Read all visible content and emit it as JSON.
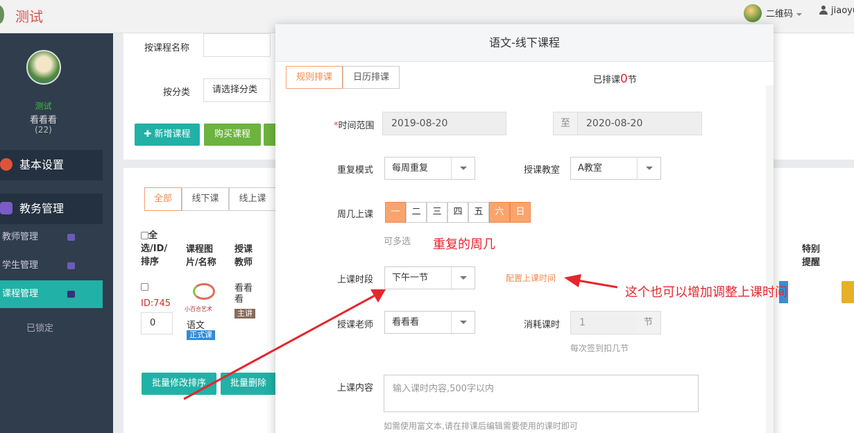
{
  "app": {
    "title": "测试"
  },
  "topbar": {
    "qr_label": "二维码",
    "user_label": "jiaoyu"
  },
  "sidebar": {
    "name_line1": "测试",
    "name_line2": "看看看",
    "count": "(22)",
    "section_basic": "基本设置",
    "section_edu": "教务管理",
    "items": [
      "教师管理",
      "学生管理",
      "课程管理"
    ],
    "locked": "已锁定"
  },
  "filters": {
    "by_name_label": "按课程名称",
    "by_category_label": "按分类",
    "category_select": "请选择分类"
  },
  "actions": {
    "new_course": "新增课程",
    "buy_course": "购买课程"
  },
  "list_tabs": [
    "全部",
    "线下课",
    "线上课"
  ],
  "table": {
    "headers": [
      "全选/ID/排序",
      "课程图片/名称",
      "授课教师",
      "特别提醒"
    ],
    "row": {
      "id": "ID:745",
      "sort": "0",
      "logo_text": "小百合艺术",
      "course_name": "语文",
      "course_tag": "正式课",
      "teacher": "看看看",
      "teacher_tag": "主讲"
    }
  },
  "bulk": {
    "edit_sort": "批量修改排序",
    "delete": "批量删除"
  },
  "modal": {
    "title": "语文-线下课程",
    "tab_rule": "规则排课",
    "tab_calendar": "日历排课",
    "scheduled_prefix": "已排课",
    "scheduled_count": "0",
    "scheduled_suffix": "节",
    "time_range_label": "时间范围",
    "date_from": "2019-08-20",
    "to_label": "至",
    "date_to": "2020-08-20",
    "repeat_label": "重复模式",
    "repeat_value": "每周重复",
    "classroom_label": "授课教室",
    "classroom_value": "A教室",
    "weekday_label": "周几上课",
    "weekdays": [
      "一",
      "二",
      "三",
      "四",
      "五",
      "六",
      "日"
    ],
    "weekday_selected": [
      true,
      false,
      false,
      false,
      false,
      true,
      true
    ],
    "multi_hint": "可多选",
    "period_label": "上课时段",
    "period_value": "下午一节",
    "config_link": "配置上课时间",
    "teacher_label": "授课老师",
    "teacher_value": "看看看",
    "consume_label": "消耗课时",
    "consume_placeholder": "1",
    "consume_unit": "节",
    "consume_hint": "每次签到扣几节",
    "content_label": "上课内容",
    "content_placeholder": "输入课时内容,500字以内",
    "richtext_hint": "如需使用富文本,请在排课后编辑需要使用的课时即可"
  },
  "annotations": {
    "repeat_weekday": "重复的周几",
    "adjust_time": "这个也可以增加调整上课时间"
  },
  "colors": {
    "accent": "#f08a50",
    "teal": "#21b1a6",
    "green": "#6cb33f",
    "annotation": "#e5262d"
  }
}
